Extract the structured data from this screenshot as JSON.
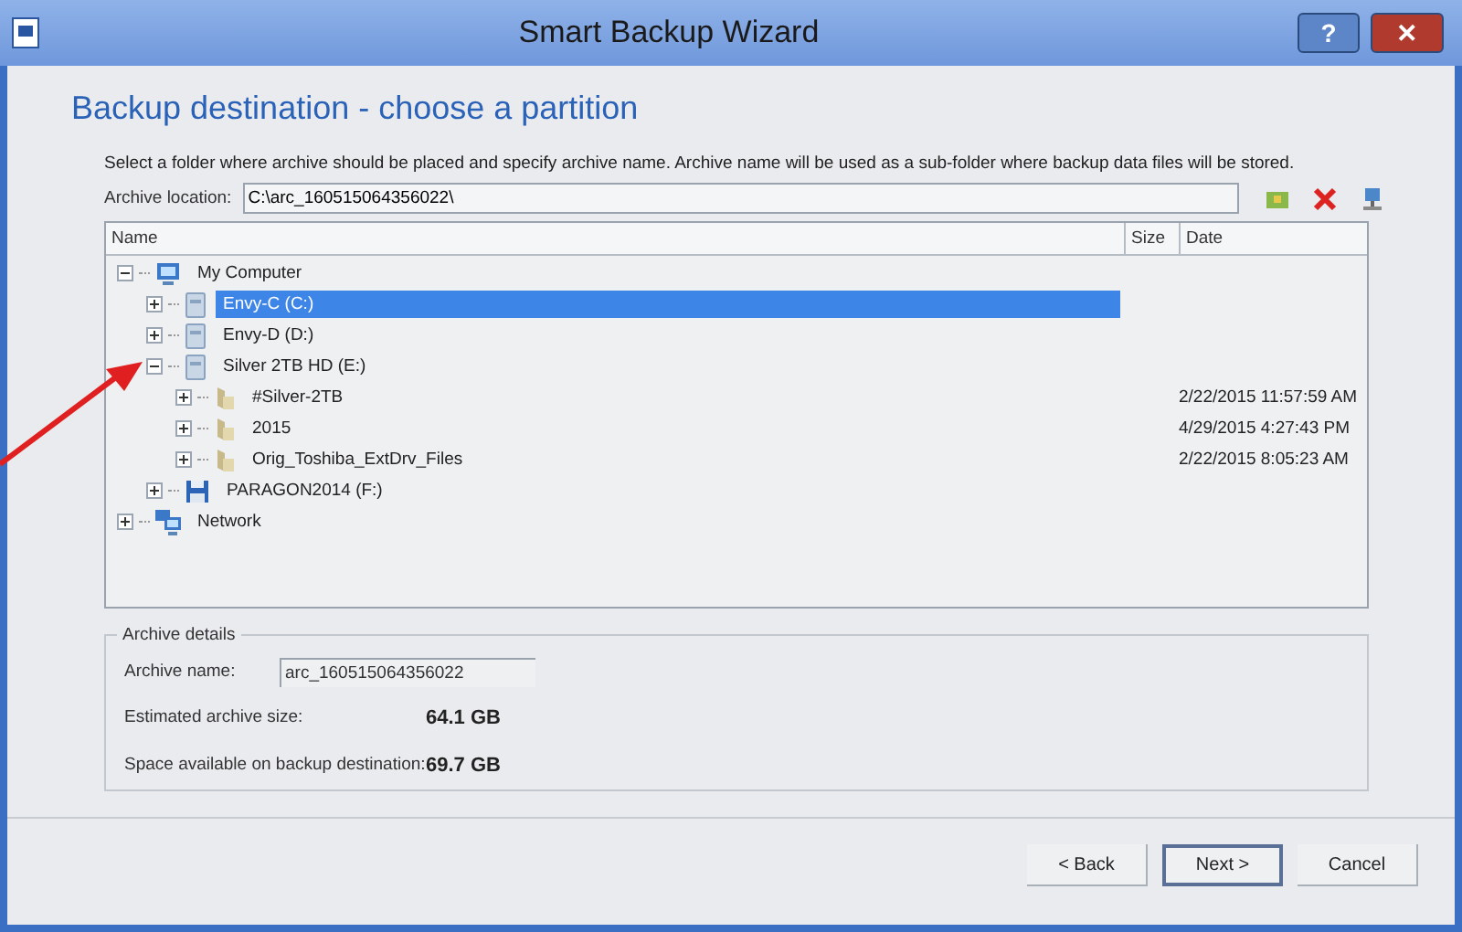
{
  "window": {
    "title": "Smart Backup Wizard"
  },
  "title_buttons": [
    {
      "kind": "help",
      "label": "?"
    },
    {
      "kind": "close",
      "label": "✕"
    }
  ],
  "heading": "Backup destination - choose a partition",
  "instruction": "Select a folder where archive should be placed and specify archive name. Archive name will be used as a sub-folder where backup data files will be stored.",
  "archive_location": {
    "label": "Archive location:",
    "value": "C:\\arc_160515064356022\\"
  },
  "table": {
    "columns": [
      "Name",
      "Size",
      "Date"
    ],
    "tree": [
      {
        "kind": "computer",
        "name": "My Computer",
        "expanded": true,
        "selected": false,
        "children": [
          {
            "kind": "drive",
            "name": "Envy-C (C:)",
            "expanded": false,
            "selected": true
          },
          {
            "kind": "drive",
            "name": "Envy-D (D:)",
            "expanded": false,
            "selected": false
          },
          {
            "kind": "drive",
            "name": "Silver 2TB HD (E:)",
            "expanded": true,
            "selected": false,
            "children": [
              {
                "kind": "folder",
                "name": "#Silver-2TB",
                "expanded": false,
                "selected": false,
                "date": "2/22/2015 11:57:59 AM"
              },
              {
                "kind": "folder",
                "name": "2015",
                "expanded": false,
                "selected": false,
                "date": "4/29/2015 4:27:43 PM"
              },
              {
                "kind": "folder",
                "name": "Orig_Toshiba_ExtDrv_Files",
                "expanded": false,
                "selected": false,
                "date": "2/22/2015 8:05:23 AM"
              }
            ]
          },
          {
            "kind": "floppy",
            "name": "PARAGON2014 (F:)",
            "expanded": false,
            "selected": false
          }
        ]
      },
      {
        "kind": "network",
        "name": "Network",
        "expanded": false,
        "selected": false
      }
    ]
  },
  "archive_details": {
    "title": "Archive details",
    "name_label": "Archive name:",
    "name_value": "arc_160515064356022",
    "rows": [
      {
        "label": "Estimated archive size:",
        "value": "64.1 GB"
      },
      {
        "label": "Space available on backup destination:",
        "value": "69.7 GB"
      }
    ]
  },
  "buttons": [
    {
      "label": "< Back",
      "selected": false
    },
    {
      "label": "Next >",
      "selected": true
    },
    {
      "label": "Cancel",
      "selected": false
    }
  ]
}
